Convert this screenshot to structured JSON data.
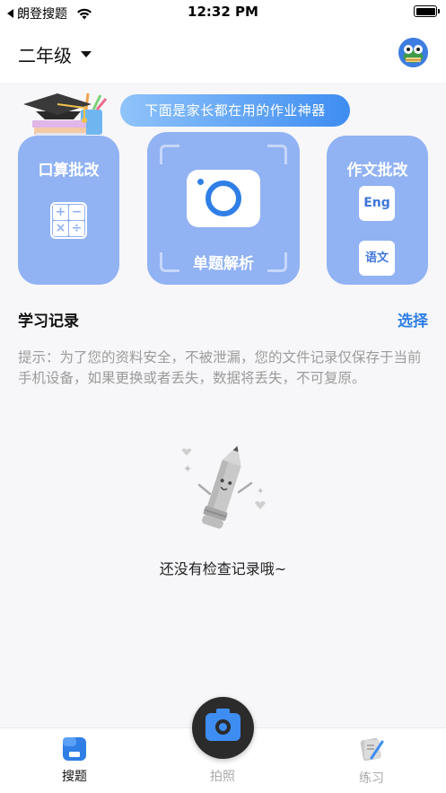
{
  "status_bar": {
    "back_app": "朗登搜题",
    "time": "12:32 PM"
  },
  "header": {
    "grade": "二年级",
    "avatar_icon": "frog-avatar-icon"
  },
  "banner": {
    "text": "下面是家长都在用的作业神器"
  },
  "features": {
    "arithmetic": {
      "title": "口算批改",
      "icon": "calculator-icon"
    },
    "single": {
      "title": "单题解析",
      "icon": "camera-icon"
    },
    "essay": {
      "title": "作文批改",
      "eng": "Eng",
      "cn": "语文"
    }
  },
  "history": {
    "title": "学习记录",
    "select": "选择",
    "tip": "提示：为了您的资料安全，不被泄漏，您的文件记录仅保存于当前手机设备，如果更换或者丢失，数据将丢失，不可复原。",
    "empty": "还没有检查记录哦~"
  },
  "tabs": {
    "search": "搜题",
    "photo": "拍照",
    "practice": "练习"
  },
  "colors": {
    "accent": "#2f7fe6",
    "card": "#91b2f3",
    "background": "#f7f7f9"
  }
}
